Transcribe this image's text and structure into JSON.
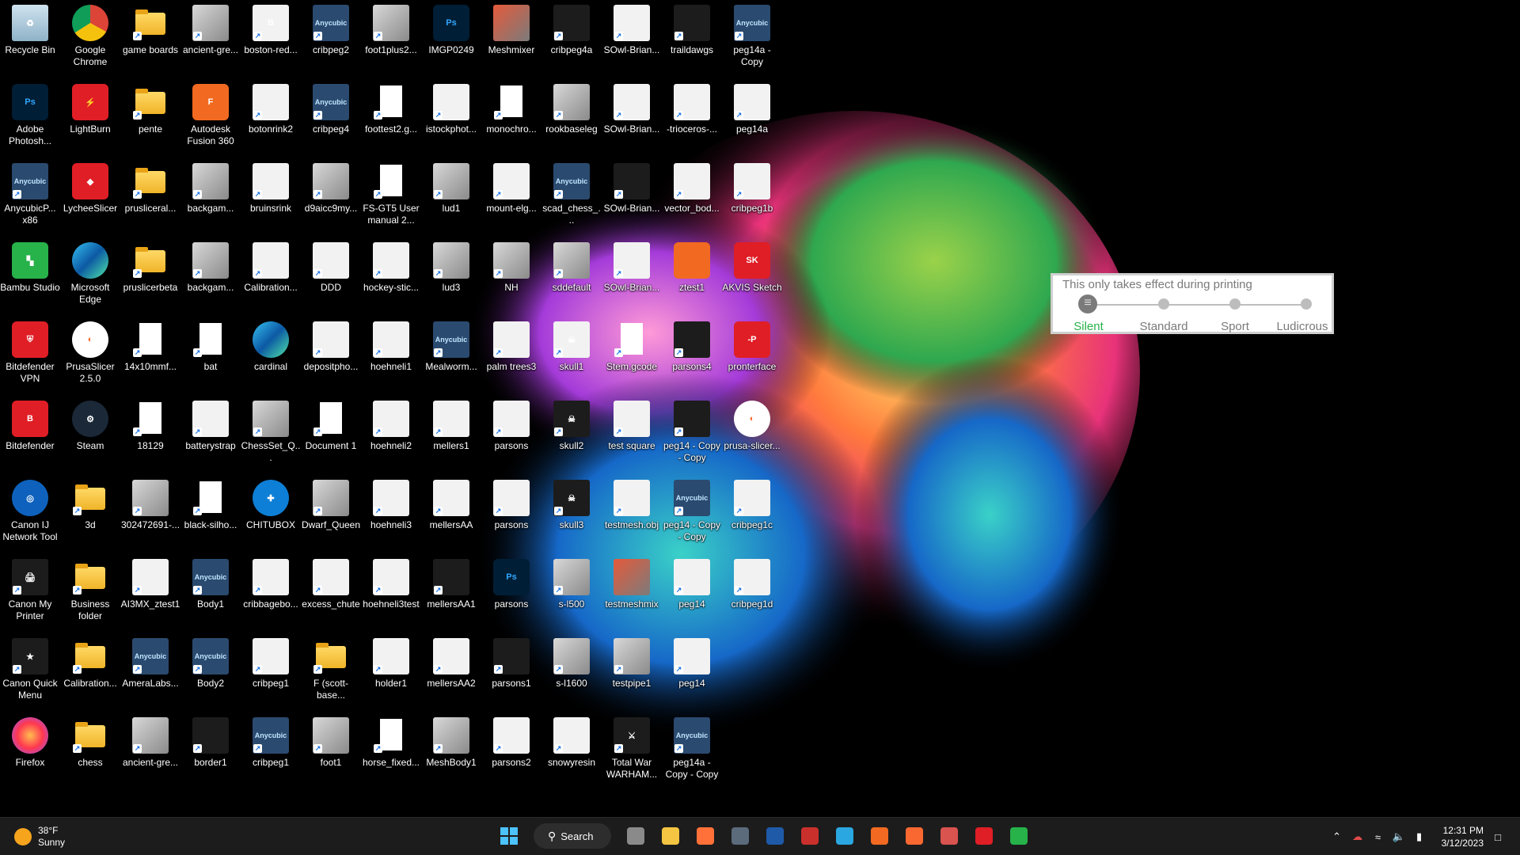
{
  "desktop": {
    "icons": [
      {
        "label": "Recycle Bin",
        "icon": "recycle-bin-icon",
        "kind": "bin",
        "glyph": "♻"
      },
      {
        "label": "Adobe Photosh...",
        "icon": "photoshop-icon",
        "kind": "ps",
        "glyph": "Ps"
      },
      {
        "label": "AnycubicP... x86",
        "icon": "anycubic-icon",
        "kind": "any",
        "glyph": "Anycubic"
      },
      {
        "label": "Bambu Studio",
        "icon": "bambu-studio-icon",
        "kind": "green",
        "glyph": "▚"
      },
      {
        "label": "Bitdefender VPN",
        "icon": "bitdefender-vpn-icon",
        "kind": "red",
        "glyph": "⛨"
      },
      {
        "label": "Bitdefender",
        "icon": "bitdefender-icon",
        "kind": "red",
        "glyph": "B"
      },
      {
        "label": "Canon IJ Network Tool",
        "icon": "globe-icon",
        "kind": "cloud",
        "glyph": "◎"
      },
      {
        "label": "Canon My Printer",
        "icon": "printer-icon",
        "kind": "dark",
        "glyph": "🖨"
      },
      {
        "label": "Canon Quick Menu",
        "icon": "quick-menu-icon",
        "kind": "dark",
        "glyph": "★"
      },
      {
        "label": "Firefox",
        "icon": "firefox-icon",
        "kind": "firefox",
        "glyph": ""
      },
      {
        "label": "Google Chrome",
        "icon": "chrome-icon",
        "kind": "chrome",
        "glyph": ""
      },
      {
        "label": "LightBurn",
        "icon": "lightburn-icon",
        "kind": "red",
        "glyph": "⚡"
      },
      {
        "label": "LycheeSlicer",
        "icon": "lychee-icon",
        "kind": "red",
        "glyph": "◆"
      },
      {
        "label": "Microsoft Edge",
        "icon": "edge-icon",
        "kind": "edge",
        "glyph": ""
      },
      {
        "label": "PrusaSlicer 2.5.0",
        "icon": "prusaslicer-icon",
        "kind": "prusa",
        "glyph": "◐"
      },
      {
        "label": "Steam",
        "icon": "steam-icon",
        "kind": "steam",
        "glyph": "⚙"
      },
      {
        "label": "3d",
        "icon": "folder-icon",
        "kind": "folder",
        "glyph": ""
      },
      {
        "label": "Business folder",
        "icon": "folder-icon",
        "kind": "folder",
        "glyph": ""
      },
      {
        "label": "Calibration...",
        "icon": "folder-icon",
        "kind": "folder",
        "glyph": ""
      },
      {
        "label": "chess",
        "icon": "folder-icon",
        "kind": "folder",
        "glyph": ""
      },
      {
        "label": "game boards",
        "icon": "folder-icon",
        "kind": "folder",
        "glyph": ""
      },
      {
        "label": "pente",
        "icon": "folder-icon",
        "kind": "folder",
        "glyph": ""
      },
      {
        "label": "prusliceral...",
        "icon": "folder-icon",
        "kind": "folder",
        "glyph": ""
      },
      {
        "label": "pruslicerbeta",
        "icon": "folder-icon",
        "kind": "folder",
        "glyph": ""
      },
      {
        "label": "14x10mmf...",
        "icon": "document-icon",
        "kind": "doc",
        "glyph": ""
      },
      {
        "label": "18129",
        "icon": "image-file-icon",
        "kind": "doc",
        "glyph": ""
      },
      {
        "label": "302472691-...",
        "icon": "image-thumbnail-icon",
        "kind": "img",
        "glyph": ""
      },
      {
        "label": "AI3MX_ztest1",
        "icon": "model-thumbnail-icon",
        "kind": "white",
        "glyph": ""
      },
      {
        "label": "AmeraLabs...",
        "icon": "anycubic-icon",
        "kind": "any",
        "glyph": "Anycubic"
      },
      {
        "label": "ancient-gre...",
        "icon": "image-thumbnail-icon",
        "kind": "img",
        "glyph": ""
      },
      {
        "label": "ancient-gre...",
        "icon": "image-thumbnail-icon",
        "kind": "img",
        "glyph": ""
      },
      {
        "label": "Autodesk Fusion 360",
        "icon": "fusion360-icon",
        "kind": "orange",
        "glyph": "F"
      },
      {
        "label": "backgam...",
        "icon": "image-thumbnail-icon",
        "kind": "img",
        "glyph": ""
      },
      {
        "label": "backgam...",
        "icon": "image-thumbnail-icon",
        "kind": "img",
        "glyph": ""
      },
      {
        "label": "bat",
        "icon": "image-file-icon",
        "kind": "doc",
        "glyph": ""
      },
      {
        "label": "batterystrap",
        "icon": "model-thumbnail-icon",
        "kind": "white",
        "glyph": ""
      },
      {
        "label": "black-silho...",
        "icon": "document-icon",
        "kind": "doc",
        "glyph": ""
      },
      {
        "label": "Body1",
        "icon": "anycubic-icon",
        "kind": "any",
        "glyph": "Anycubic"
      },
      {
        "label": "Body2",
        "icon": "anycubic-icon",
        "kind": "any",
        "glyph": "Anycubic"
      },
      {
        "label": "border1",
        "icon": "model-thumbnail-icon",
        "kind": "dark",
        "glyph": ""
      },
      {
        "label": "boston-red...",
        "icon": "image-thumbnail-icon",
        "kind": "white",
        "glyph": "B"
      },
      {
        "label": "botonrink2",
        "icon": "image-thumbnail-icon",
        "kind": "white",
        "glyph": ""
      },
      {
        "label": "bruinsrink",
        "icon": "image-thumbnail-icon",
        "kind": "white",
        "glyph": ""
      },
      {
        "label": "Calibration...",
        "icon": "image-thumbnail-icon",
        "kind": "white",
        "glyph": ""
      },
      {
        "label": "cardinal",
        "icon": "edge-icon",
        "kind": "edge",
        "glyph": ""
      },
      {
        "label": "ChessSet_Q...",
        "icon": "model-thumbnail-icon",
        "kind": "img",
        "glyph": ""
      },
      {
        "label": "CHITUBOX",
        "icon": "chitubox-icon",
        "kind": "blue",
        "glyph": "✚"
      },
      {
        "label": "cribbagebo...",
        "icon": "model-thumbnail-icon",
        "kind": "white",
        "glyph": ""
      },
      {
        "label": "cribpeg1",
        "icon": "model-thumbnail-icon",
        "kind": "white",
        "glyph": ""
      },
      {
        "label": "cribpeg1",
        "icon": "anycubic-icon",
        "kind": "any",
        "glyph": "Anycubic"
      },
      {
        "label": "cribpeg2",
        "icon": "anycubic-icon",
        "kind": "any",
        "glyph": "Anycubic"
      },
      {
        "label": "cribpeg4",
        "icon": "anycubic-icon",
        "kind": "any",
        "glyph": "Anycubic"
      },
      {
        "label": "d9aicc9my...",
        "icon": "image-thumbnail-icon",
        "kind": "img",
        "glyph": ""
      },
      {
        "label": "DDD",
        "icon": "model-thumbnail-icon",
        "kind": "white",
        "glyph": ""
      },
      {
        "label": "depositpho...",
        "icon": "image-thumbnail-icon",
        "kind": "white",
        "glyph": ""
      },
      {
        "label": "Document 1",
        "icon": "word-document-icon",
        "kind": "doc",
        "glyph": ""
      },
      {
        "label": "Dwarf_Queen",
        "icon": "model-thumbnail-icon",
        "kind": "img",
        "glyph": ""
      },
      {
        "label": "excess_chute",
        "icon": "model-thumbnail-icon",
        "kind": "white",
        "glyph": ""
      },
      {
        "label": "F (scott-base...",
        "icon": "folder-icon",
        "kind": "folder",
        "glyph": ""
      },
      {
        "label": "foot1",
        "icon": "model-thumbnail-icon",
        "kind": "img",
        "glyph": ""
      },
      {
        "label": "foot1plus2...",
        "icon": "model-thumbnail-icon",
        "kind": "img",
        "glyph": ""
      },
      {
        "label": "foottest2.g...",
        "icon": "document-icon",
        "kind": "doc",
        "glyph": ""
      },
      {
        "label": "FS-GT5 User manual 2...",
        "icon": "pdf-document-icon",
        "kind": "doc",
        "glyph": ""
      },
      {
        "label": "hockey-stic...",
        "icon": "image-thumbnail-icon",
        "kind": "white",
        "glyph": ""
      },
      {
        "label": "hoehneli1",
        "icon": "model-thumbnail-icon",
        "kind": "white",
        "glyph": ""
      },
      {
        "label": "hoehneli2",
        "icon": "model-thumbnail-icon",
        "kind": "white",
        "glyph": ""
      },
      {
        "label": "hoehneli3",
        "icon": "model-thumbnail-icon",
        "kind": "white",
        "glyph": ""
      },
      {
        "label": "hoehneli3test",
        "icon": "model-thumbnail-icon",
        "kind": "white",
        "glyph": ""
      },
      {
        "label": "holder1",
        "icon": "model-thumbnail-icon",
        "kind": "white",
        "glyph": ""
      },
      {
        "label": "horse_fixed...",
        "icon": "document-icon",
        "kind": "doc",
        "glyph": ""
      },
      {
        "label": "IMGP0249",
        "icon": "photoshop-icon",
        "kind": "ps",
        "glyph": "Ps"
      },
      {
        "label": "istockphot...",
        "icon": "image-thumbnail-icon",
        "kind": "white",
        "glyph": ""
      },
      {
        "label": "lud1",
        "icon": "image-thumbnail-icon",
        "kind": "img",
        "glyph": ""
      },
      {
        "label": "lud3",
        "icon": "image-thumbnail-icon",
        "kind": "img",
        "glyph": ""
      },
      {
        "label": "Mealworm...",
        "icon": "anycubic-icon",
        "kind": "any",
        "glyph": "Anycubic"
      },
      {
        "label": "mellers1",
        "icon": "model-thumbnail-icon",
        "kind": "white",
        "glyph": ""
      },
      {
        "label": "mellersAA",
        "icon": "model-thumbnail-icon",
        "kind": "white",
        "glyph": ""
      },
      {
        "label": "mellersAA1",
        "icon": "model-thumbnail-icon",
        "kind": "dark",
        "glyph": ""
      },
      {
        "label": "mellersAA2",
        "icon": "model-thumbnail-icon",
        "kind": "white",
        "glyph": ""
      },
      {
        "label": "MeshBody1",
        "icon": "model-thumbnail-icon",
        "kind": "img",
        "glyph": ""
      },
      {
        "label": "Meshmixer",
        "icon": "meshmixer-icon",
        "kind": "meshmix",
        "glyph": ""
      },
      {
        "label": "monochro...",
        "icon": "document-icon",
        "kind": "doc",
        "glyph": ""
      },
      {
        "label": "mount-elg...",
        "icon": "model-thumbnail-icon",
        "kind": "white",
        "glyph": ""
      },
      {
        "label": "NH",
        "icon": "model-thumbnail-icon",
        "kind": "img",
        "glyph": ""
      },
      {
        "label": "palm trees3",
        "icon": "image-thumbnail-icon",
        "kind": "white",
        "glyph": ""
      },
      {
        "label": "parsons",
        "icon": "image-thumbnail-icon",
        "kind": "white",
        "glyph": ""
      },
      {
        "label": "parsons",
        "icon": "model-thumbnail-icon",
        "kind": "white",
        "glyph": ""
      },
      {
        "label": "parsons",
        "icon": "photoshop-icon",
        "kind": "ps",
        "glyph": "Ps"
      },
      {
        "label": "parsons1",
        "icon": "model-thumbnail-icon",
        "kind": "dark",
        "glyph": ""
      },
      {
        "label": "parsons2",
        "icon": "model-thumbnail-icon",
        "kind": "white",
        "glyph": ""
      },
      {
        "label": "cribpeg4a",
        "icon": "model-thumbnail-icon",
        "kind": "dark",
        "glyph": ""
      },
      {
        "label": "rookbaseleg",
        "icon": "model-thumbnail-icon",
        "kind": "img",
        "glyph": ""
      },
      {
        "label": "scad_chess_...",
        "icon": "anycubic-icon",
        "kind": "any",
        "glyph": "Anycubic"
      },
      {
        "label": "sddefault",
        "icon": "image-thumbnail-icon",
        "kind": "img",
        "glyph": ""
      },
      {
        "label": "skull1",
        "icon": "model-thumbnail-icon",
        "kind": "white",
        "glyph": "☠"
      },
      {
        "label": "skull2",
        "icon": "model-thumbnail-icon",
        "kind": "dark",
        "glyph": "☠"
      },
      {
        "label": "skull3",
        "icon": "model-thumbnail-icon",
        "kind": "dark",
        "glyph": "☠"
      },
      {
        "label": "s-l500",
        "icon": "image-thumbnail-icon",
        "kind": "img",
        "glyph": ""
      },
      {
        "label": "s-l1600",
        "icon": "image-thumbnail-icon",
        "kind": "img",
        "glyph": ""
      },
      {
        "label": "snowyresin",
        "icon": "model-thumbnail-icon",
        "kind": "white",
        "glyph": ""
      },
      {
        "label": "SOwl-Brian...",
        "icon": "model-thumbnail-icon",
        "kind": "white",
        "glyph": ""
      },
      {
        "label": "SOwl-Brian...",
        "icon": "model-thumbnail-icon",
        "kind": "white",
        "glyph": ""
      },
      {
        "label": "SOwl-Brian...",
        "icon": "model-thumbnail-icon",
        "kind": "dark",
        "glyph": ""
      },
      {
        "label": "SOwl-Brian...",
        "icon": "model-thumbnail-icon",
        "kind": "white",
        "glyph": ""
      },
      {
        "label": "Stem.gcode",
        "icon": "document-icon",
        "kind": "doc",
        "glyph": ""
      },
      {
        "label": "test square",
        "icon": "model-thumbnail-icon",
        "kind": "white",
        "glyph": ""
      },
      {
        "label": "testmesh.obj",
        "icon": "model-thumbnail-icon",
        "kind": "white",
        "glyph": ""
      },
      {
        "label": "testmeshmix",
        "icon": "meshmixer-icon",
        "kind": "meshmix",
        "glyph": ""
      },
      {
        "label": "testpipe1",
        "icon": "model-thumbnail-icon",
        "kind": "img",
        "glyph": ""
      },
      {
        "label": "Total War WARHAM...",
        "icon": "game-icon",
        "kind": "dark",
        "glyph": "⚔"
      },
      {
        "label": "traildawgs",
        "icon": "image-thumbnail-icon",
        "kind": "dark",
        "glyph": ""
      },
      {
        "label": "-trioceros-...",
        "icon": "image-thumbnail-icon",
        "kind": "white",
        "glyph": ""
      },
      {
        "label": "vector_bod...",
        "icon": "image-thumbnail-icon",
        "kind": "white",
        "glyph": ""
      },
      {
        "label": "ztest1",
        "icon": "model-thumbnail-icon",
        "kind": "orange",
        "glyph": ""
      },
      {
        "label": "parsons4",
        "icon": "model-thumbnail-icon",
        "kind": "dark",
        "glyph": ""
      },
      {
        "label": "peg14 - Copy - Copy",
        "icon": "model-thumbnail-icon",
        "kind": "dark",
        "glyph": ""
      },
      {
        "label": "peg14 - Copy - Copy",
        "icon": "anycubic-icon",
        "kind": "any",
        "glyph": "Anycubic"
      },
      {
        "label": "peg14",
        "icon": "model-thumbnail-icon",
        "kind": "white",
        "glyph": ""
      },
      {
        "label": "peg14",
        "icon": "model-thumbnail-icon",
        "kind": "white",
        "glyph": ""
      },
      {
        "label": "peg14a - Copy - Copy",
        "icon": "anycubic-icon",
        "kind": "any",
        "glyph": "Anycubic"
      },
      {
        "label": "peg14a - Copy",
        "icon": "anycubic-icon",
        "kind": "any",
        "glyph": "Anycubic"
      },
      {
        "label": "peg14a",
        "icon": "model-thumbnail-icon",
        "kind": "white",
        "glyph": ""
      },
      {
        "label": "cribpeg1b",
        "icon": "model-thumbnail-icon",
        "kind": "white",
        "glyph": ""
      },
      {
        "label": "AKVIS Sketch",
        "icon": "akvis-sketch-icon",
        "kind": "red",
        "glyph": "SK"
      },
      {
        "label": "pronterface",
        "icon": "pronterface-icon",
        "kind": "red",
        "glyph": "-P"
      },
      {
        "label": "prusa-slicer...",
        "icon": "prusaslicer-icon",
        "kind": "prusa",
        "glyph": "◐"
      },
      {
        "label": "cribpeg1c",
        "icon": "model-thumbnail-icon",
        "kind": "white",
        "glyph": ""
      },
      {
        "label": "cribpeg1d",
        "icon": "model-thumbnail-icon",
        "kind": "white",
        "glyph": ""
      }
    ]
  },
  "speed_panel": {
    "note": "This only takes effect during printing",
    "levels": [
      "Silent",
      "Standard",
      "Sport",
      "Ludicrous"
    ],
    "selected": "Silent",
    "selected_index": 0,
    "selected_color": "#27b24a"
  },
  "taskbar": {
    "weather": {
      "temp": "38°F",
      "condition": "Sunny",
      "icon": "sun-icon"
    },
    "search_label": "Search",
    "apps": [
      {
        "name": "task-view-icon",
        "color": "#8a8a8a"
      },
      {
        "name": "file-explorer-icon",
        "color": "#f4c542"
      },
      {
        "name": "firefox-icon",
        "color": "#ff7139"
      },
      {
        "name": "calculator-icon",
        "color": "#5b6b7c"
      },
      {
        "name": "photoshop-icon",
        "color": "#1e5aa8"
      },
      {
        "name": "lightburn-icon",
        "color": "#c9302c"
      },
      {
        "name": "canon-icon",
        "color": "#2aa7e0"
      },
      {
        "name": "fusion360-icon",
        "color": "#f26a21"
      },
      {
        "name": "prusaslicer-icon",
        "color": "#fa6831"
      },
      {
        "name": "meshmixer-icon",
        "color": "#d9534f"
      },
      {
        "name": "pronterface-icon",
        "color": "#e01e26"
      },
      {
        "name": "bambu-studio-icon",
        "color": "#27b24a"
      }
    ],
    "time": "12:31 PM",
    "date": "3/12/2023"
  }
}
